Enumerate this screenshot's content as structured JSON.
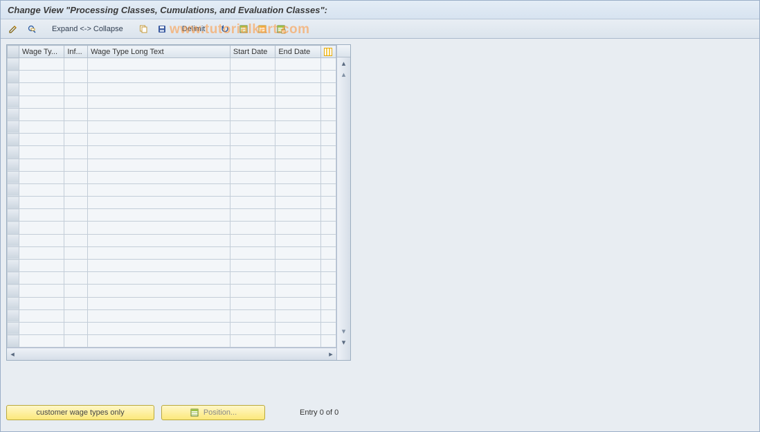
{
  "title": "Change View \"Processing Classes, Cumulations, and Evaluation Classes\":",
  "toolbar": {
    "expand_label": "Expand <-> Collapse",
    "delimit_label": "Delimit"
  },
  "watermark": "www.tutorialkart.com",
  "table": {
    "columns": [
      "Wage Ty...",
      "Inf...",
      "Wage Type Long Text",
      "Start Date",
      "End Date"
    ],
    "rows": [
      [
        "",
        "",
        "",
        "",
        ""
      ],
      [
        "",
        "",
        "",
        "",
        ""
      ],
      [
        "",
        "",
        "",
        "",
        ""
      ],
      [
        "",
        "",
        "",
        "",
        ""
      ],
      [
        "",
        "",
        "",
        "",
        ""
      ],
      [
        "",
        "",
        "",
        "",
        ""
      ],
      [
        "",
        "",
        "",
        "",
        ""
      ],
      [
        "",
        "",
        "",
        "",
        ""
      ],
      [
        "",
        "",
        "",
        "",
        ""
      ],
      [
        "",
        "",
        "",
        "",
        ""
      ],
      [
        "",
        "",
        "",
        "",
        ""
      ],
      [
        "",
        "",
        "",
        "",
        ""
      ],
      [
        "",
        "",
        "",
        "",
        ""
      ],
      [
        "",
        "",
        "",
        "",
        ""
      ],
      [
        "",
        "",
        "",
        "",
        ""
      ],
      [
        "",
        "",
        "",
        "",
        ""
      ],
      [
        "",
        "",
        "",
        "",
        ""
      ],
      [
        "",
        "",
        "",
        "",
        ""
      ],
      [
        "",
        "",
        "",
        "",
        ""
      ],
      [
        "",
        "",
        "",
        "",
        ""
      ],
      [
        "",
        "",
        "",
        "",
        ""
      ],
      [
        "",
        "",
        "",
        "",
        ""
      ],
      [
        "",
        "",
        "",
        "",
        ""
      ]
    ]
  },
  "footer": {
    "customer_btn": "customer wage types only",
    "position_btn": "Position...",
    "entry_text": "Entry 0 of 0"
  }
}
